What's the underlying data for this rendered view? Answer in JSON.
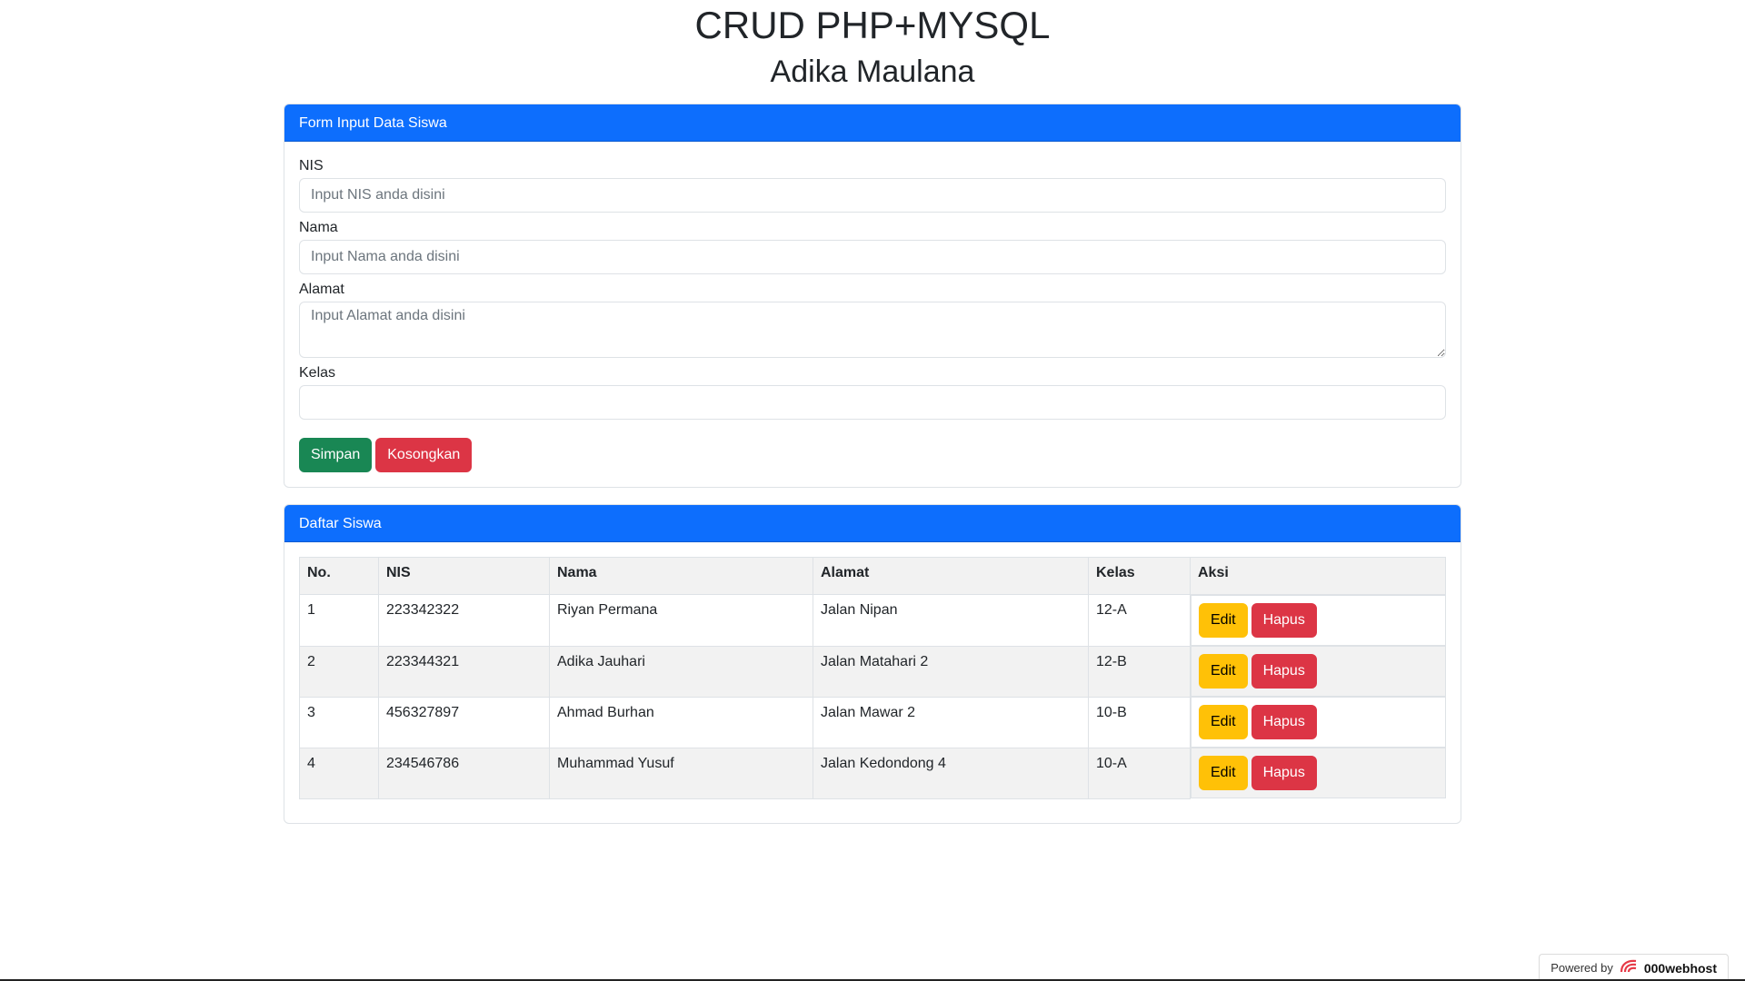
{
  "header": {
    "title": "CRUD PHP+MYSQL",
    "subtitle": "Adika Maulana"
  },
  "form_card": {
    "title": "Form Input Data Siswa",
    "fields": {
      "nis": {
        "label": "NIS",
        "placeholder": "Input NIS anda disini",
        "value": ""
      },
      "nama": {
        "label": "Nama",
        "placeholder": "Input Nama anda disini",
        "value": ""
      },
      "alamat": {
        "label": "Alamat",
        "placeholder": "Input Alamat anda disini",
        "value": ""
      },
      "kelas": {
        "label": "Kelas",
        "placeholder": "",
        "value": ""
      }
    },
    "save_label": "Simpan",
    "clear_label": "Kosongkan"
  },
  "list_card": {
    "title": "Daftar Siswa",
    "columns": [
      "No.",
      "NIS",
      "Nama",
      "Alamat",
      "Kelas",
      "Aksi"
    ],
    "rows": [
      {
        "no": "1",
        "nis": "223342322",
        "nama": "Riyan Permana",
        "alamat": "Jalan Nipan",
        "kelas": "12-A",
        "edit": "Edit",
        "hapus": "Hapus"
      },
      {
        "no": "2",
        "nis": "223344321",
        "nama": "Adika Jauhari",
        "alamat": "Jalan Matahari 2",
        "kelas": "12-B",
        "edit": "Edit",
        "hapus": "Hapus"
      },
      {
        "no": "3",
        "nis": "456327897",
        "nama": "Ahmad Burhan",
        "alamat": "Jalan Mawar 2",
        "kelas": "10-B",
        "edit": "Edit",
        "hapus": "Hapus"
      },
      {
        "no": "4",
        "nis": "234546786",
        "nama": "Muhammad Yusuf",
        "alamat": "Jalan Kedondong 4",
        "kelas": "10-A",
        "edit": "Edit",
        "hapus": "Hapus"
      }
    ]
  },
  "footer": {
    "powered_by": "Powered by",
    "brand": "000webhost",
    "brand_icon": "000webhost-logo-icon"
  },
  "colors": {
    "primary": "#0d6efd",
    "success": "#198754",
    "danger": "#dc3545",
    "warning": "#ffc107",
    "brand_red": "#e63946"
  }
}
